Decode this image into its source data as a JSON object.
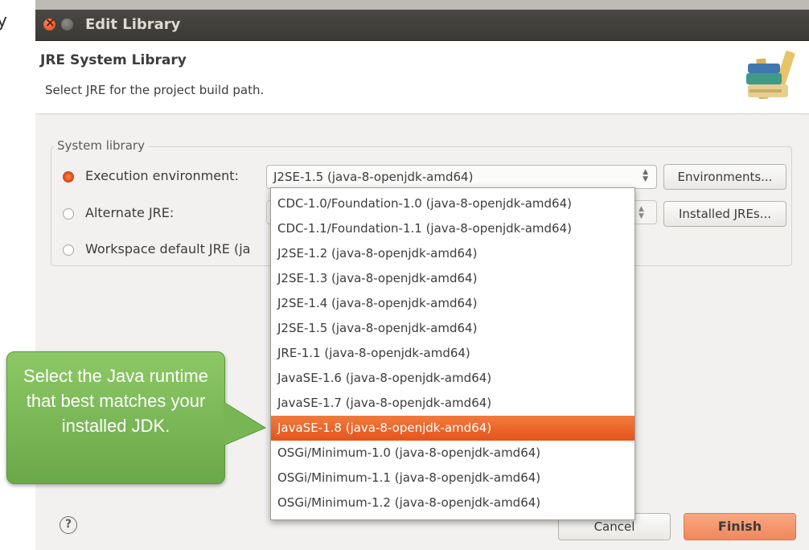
{
  "edge_text": "y",
  "window": {
    "title": "Edit Library"
  },
  "header": {
    "title": "JRE System Library",
    "subtitle": "Select JRE for the project build path."
  },
  "group": {
    "title": "System library",
    "options": [
      {
        "label": "Execution environment:",
        "checked": true
      },
      {
        "label": "Alternate JRE:",
        "checked": false
      },
      {
        "label": "Workspace default JRE (ja",
        "checked": false
      }
    ],
    "execution_env_value": "J2SE-1.5 (java-8-openjdk-amd64)",
    "environments_button": "Environments...",
    "installed_jres_button": "Installed JREs..."
  },
  "dropdown": {
    "selected_index": 9,
    "items": [
      "CDC-1.0/Foundation-1.0 (java-8-openjdk-amd64)",
      "CDC-1.1/Foundation-1.1 (java-8-openjdk-amd64)",
      "J2SE-1.2 (java-8-openjdk-amd64)",
      "J2SE-1.3 (java-8-openjdk-amd64)",
      "J2SE-1.4 (java-8-openjdk-amd64)",
      "J2SE-1.5 (java-8-openjdk-amd64)",
      "JRE-1.1 (java-8-openjdk-amd64)",
      "JavaSE-1.6 (java-8-openjdk-amd64)",
      "JavaSE-1.7 (java-8-openjdk-amd64)",
      "JavaSE-1.8 (java-8-openjdk-amd64)",
      "OSGi/Minimum-1.0 (java-8-openjdk-amd64)",
      "OSGi/Minimum-1.1 (java-8-openjdk-amd64)",
      "OSGi/Minimum-1.2 (java-8-openjdk-amd64)"
    ]
  },
  "footer": {
    "help_symbol": "?",
    "cancel_label": "Cancel",
    "finish_label": "Finish"
  },
  "callout": {
    "text": "Select the Java runtime that best matches your installed JDK."
  },
  "colors": {
    "accent_orange": "#e9541c",
    "titlebar": "#3c3b37",
    "callout_green": "#7ab857"
  }
}
